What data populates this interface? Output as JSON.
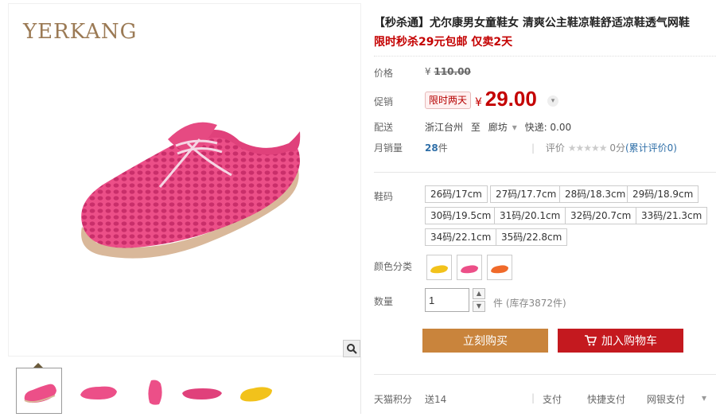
{
  "brand": {
    "logo_text": "YERKANG"
  },
  "product": {
    "title": "【秒杀通】尤尔康男女童鞋女 清爽公主鞋凉鞋舒适凉鞋透气网鞋",
    "promo_text": "限时秒杀29元包邮 仅卖2天"
  },
  "price": {
    "orig_label": "价格",
    "orig_currency": "¥",
    "orig_value": "110.00",
    "promo_label": "促销",
    "promo_tag": "限时两天",
    "promo_currency": "¥",
    "promo_value": "29.00"
  },
  "shipping": {
    "label": "配送",
    "origin": "浙江台州",
    "to": "至",
    "destination": "廊坊",
    "fee": "快递: 0.00"
  },
  "sales": {
    "label": "月销量",
    "count": "28",
    "unit": "件",
    "rating_label": "评价",
    "stars": "★★★★★",
    "rating_score": "0分",
    "rating_link": "(累计评价0)"
  },
  "sizes": {
    "label": "鞋码",
    "options": [
      "26码/17cm",
      "27码/17.7cm",
      "28码/18.3cm",
      "29码/18.9cm",
      "30码/19.5cm",
      "31码/20.1cm",
      "32码/20.7cm",
      "33码/21.3cm",
      "34码/22.1cm",
      "35码/22.8cm"
    ]
  },
  "colors": {
    "label": "颜色分类",
    "swatches": [
      "yellow",
      "pink",
      "orange"
    ],
    "hex": [
      "#f2c21b",
      "#ec4f88",
      "#f06a2a"
    ]
  },
  "quantity": {
    "label": "数量",
    "value": "1",
    "stock_text": "件 (库存3872件)"
  },
  "actions": {
    "buy_now": "立刻购买",
    "add_to_cart": "加入购物车"
  },
  "footer": {
    "points_label": "天猫积分",
    "points_value": "送14",
    "pay_label": "支付",
    "quick_pay": "快捷支付",
    "bank_pay": "网银支付"
  },
  "colors_theme": {
    "price_red": "#c40000",
    "buy_orange": "#c9843c",
    "cart_red": "#c4191f",
    "shoe_pink": "#ec4f88"
  }
}
